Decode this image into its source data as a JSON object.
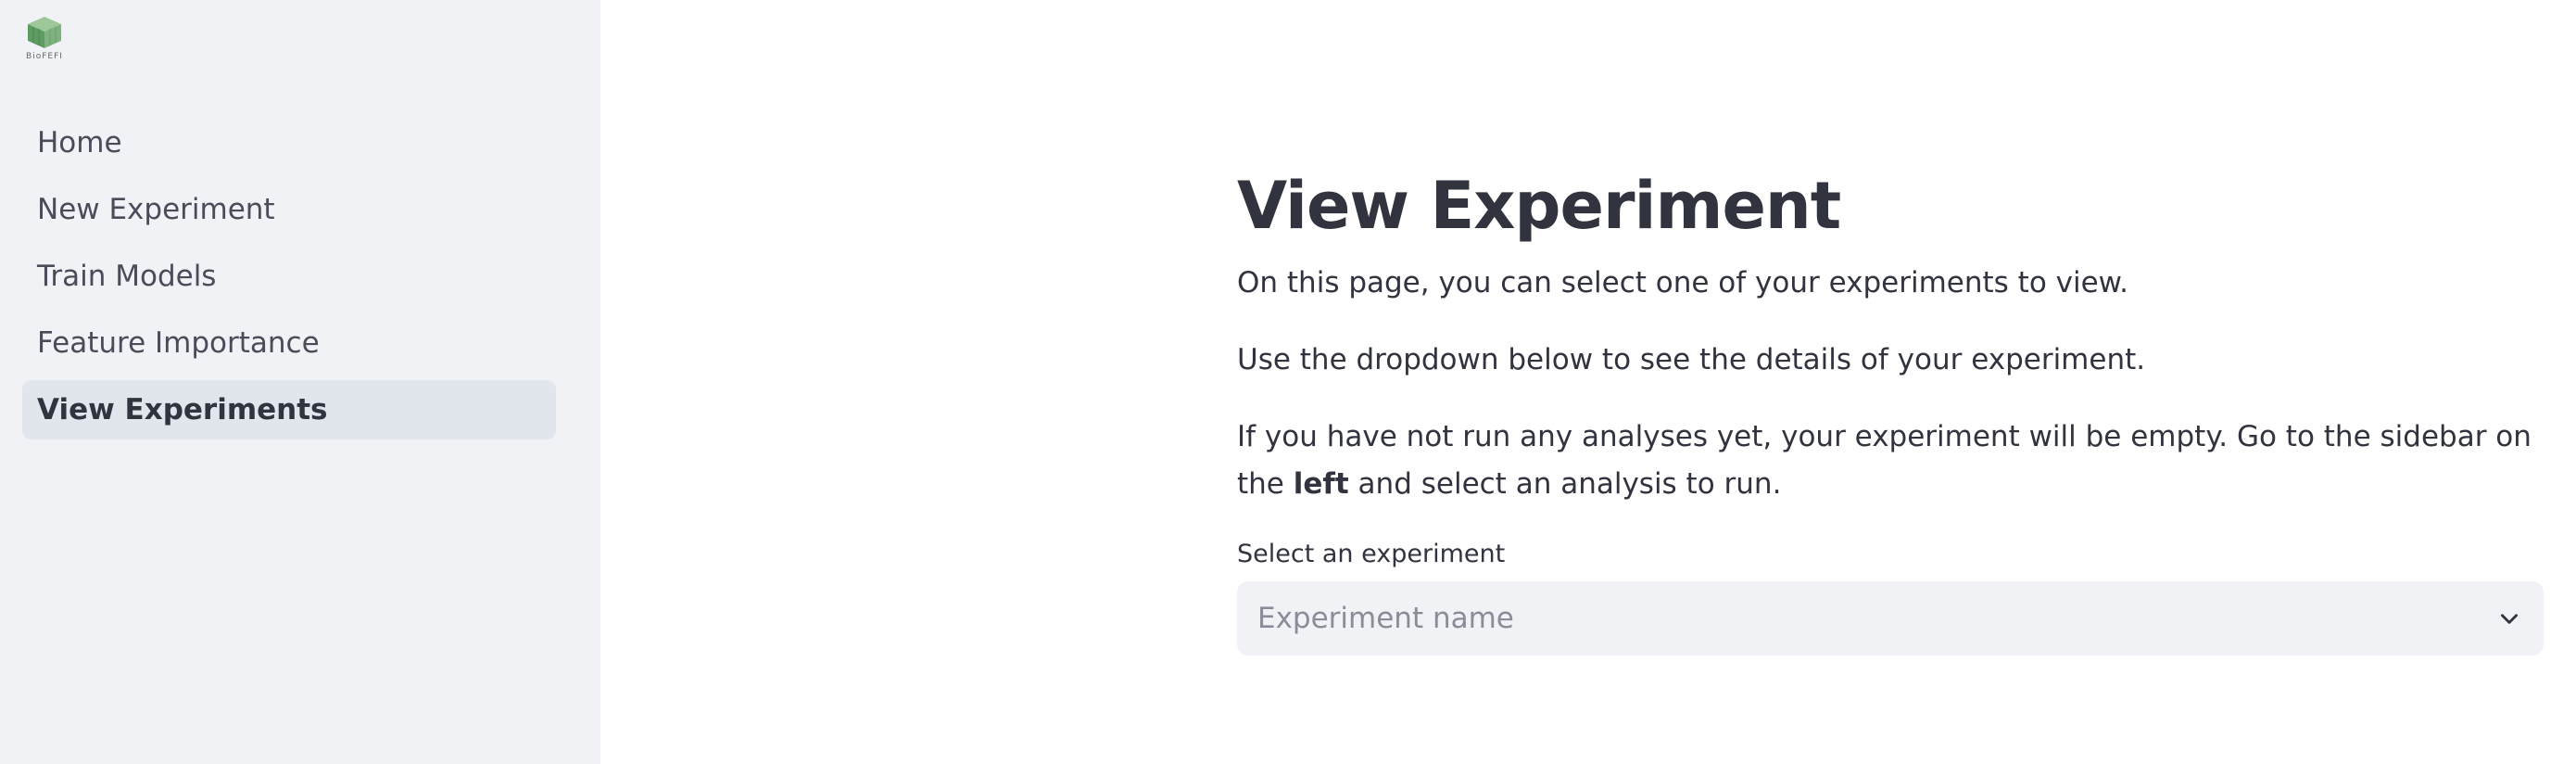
{
  "sidebar": {
    "logo_text": "BioFEFI",
    "items": [
      {
        "label": "Home",
        "active": false
      },
      {
        "label": "New Experiment",
        "active": false
      },
      {
        "label": "Train Models",
        "active": false
      },
      {
        "label": "Feature Importance",
        "active": false
      },
      {
        "label": "View Experiments",
        "active": true
      }
    ]
  },
  "main": {
    "title": "View Experiment",
    "p1": "On this page, you can select one of your experiments to view.",
    "p2": "Use the dropdown below to see the details of your experiment.",
    "p3_before": "If you have not run any analyses yet, your experiment will be empty. Go to the sidebar on the ",
    "p3_bold": "left",
    "p3_after": " and select an analysis to run.",
    "select_label": "Select an experiment",
    "select_placeholder": "Experiment name"
  },
  "colors": {
    "sidebar_bg": "#f0f2f6",
    "active_item_bg": "#e1e5ec",
    "text": "#31333f",
    "placeholder": "#8a8d98"
  },
  "icons": [
    "cube-logo-icon",
    "chevron-down-icon"
  ]
}
